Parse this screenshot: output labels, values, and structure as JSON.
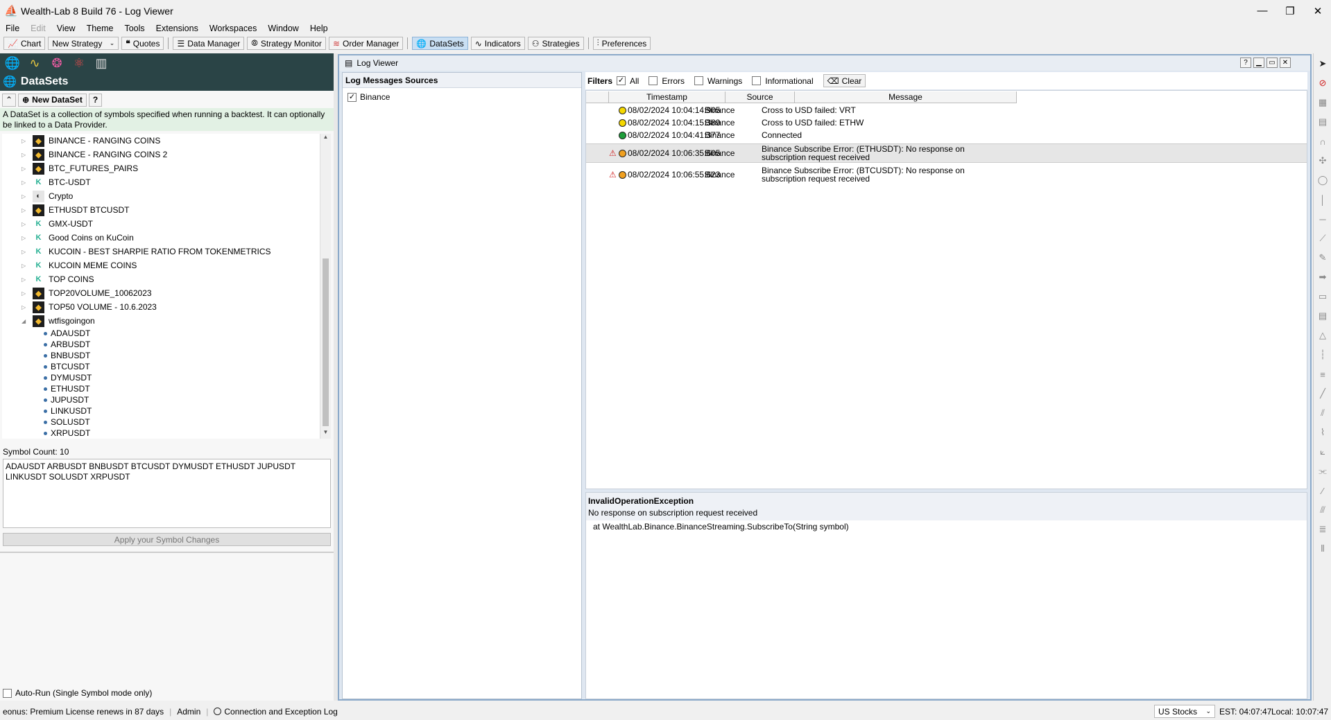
{
  "window": {
    "title": "Wealth-Lab 8 Build 76 - Log Viewer",
    "minimize": "—",
    "restore": "❐",
    "close": "✕"
  },
  "menu": [
    "File",
    "Edit",
    "View",
    "Theme",
    "Tools",
    "Extensions",
    "Workspaces",
    "Window",
    "Help"
  ],
  "toolbar": {
    "chart": "Chart",
    "new_strategy": "New Strategy",
    "quotes": "Quotes",
    "data_manager": "Data Manager",
    "strategy_monitor": "Strategy Monitor",
    "order_manager": "Order Manager",
    "datasets": "DataSets",
    "indicators": "Indicators",
    "strategies": "Strategies",
    "preferences": "Preferences"
  },
  "datasets_panel": {
    "title": "DataSets",
    "new_dataset": "New DataSet",
    "help": "?",
    "description": "A DataSet is a collection of symbols specified when running a backtest. It can optionally be linked to a Data Provider.",
    "items": [
      {
        "name": "BINANCE - RANGING COINS",
        "provider": "binance"
      },
      {
        "name": "BINANCE - RANGING COINS 2",
        "provider": "binance"
      },
      {
        "name": "BTC_FUTURES_PAIRS",
        "provider": "binance"
      },
      {
        "name": "BTC-USDT",
        "provider": "kucoin"
      },
      {
        "name": "Crypto",
        "provider": "other"
      },
      {
        "name": "ETHUSDT BTCUSDT",
        "provider": "binance"
      },
      {
        "name": "GMX-USDT",
        "provider": "kucoin"
      },
      {
        "name": "Good Coins on KuCoin",
        "provider": "kucoin"
      },
      {
        "name": "KUCOIN - BEST SHARPIE RATIO FROM TOKENMETRICS",
        "provider": "kucoin"
      },
      {
        "name": "KUCOIN MEME COINS",
        "provider": "kucoin"
      },
      {
        "name": "TOP COINS",
        "provider": "kucoin"
      },
      {
        "name": "TOP20VOLUME_10062023",
        "provider": "binance"
      },
      {
        "name": "TOP50 VOLUME - 10.6.2023",
        "provider": "binance"
      },
      {
        "name": "wtfisgoingon",
        "provider": "binance"
      }
    ],
    "expanded_symbols": [
      "ADAUSDT",
      "ARBUSDT",
      "BNBUSDT",
      "BTCUSDT",
      "DYMUSDT",
      "ETHUSDT",
      "JUPUSDT",
      "LINKUSDT",
      "SOLUSDT",
      "XRPUSDT"
    ],
    "symbol_count": "Symbol Count: 10",
    "symbols_text": "ADAUSDT ARBUSDT BNBUSDT BTCUSDT DYMUSDT ETHUSDT JUPUSDT LINKUSDT SOLUSDT XRPUSDT",
    "apply": "Apply your Symbol Changes",
    "autorun": "Auto-Run (Single Symbol mode only)"
  },
  "log_viewer": {
    "title": "Log Viewer",
    "sources_header": "Log Messages Sources",
    "sources": [
      {
        "name": "Binance",
        "checked": true
      }
    ],
    "filters_label": "Filters",
    "filters": {
      "all": "All",
      "errors": "Errors",
      "warnings": "Warnings",
      "informational": "Informational",
      "clear": "Clear"
    },
    "columns": {
      "timestamp": "Timestamp",
      "source": "Source",
      "message": "Message"
    },
    "rows": [
      {
        "warn": false,
        "dot": "#f5d800",
        "timestamp": "08/02/2024 10:04:14:905",
        "source": "Binance",
        "message": "Cross to USD failed: VRT",
        "message2": ""
      },
      {
        "warn": false,
        "dot": "#f5d800",
        "timestamp": "08/02/2024 10:04:15:389",
        "source": "Binance",
        "message": "Cross to USD failed: ETHW",
        "message2": ""
      },
      {
        "warn": false,
        "dot": "#1e9e3a",
        "timestamp": "08/02/2024 10:04:41:377",
        "source": "Binance",
        "message": "Connected",
        "message2": ""
      },
      {
        "warn": true,
        "dot": "#f0a020",
        "timestamp": "08/02/2024 10:06:35:605",
        "source": "Binance",
        "message": "Binance Subscribe Error: (ETHUSDT): No response on",
        "message2": "subscription request received"
      },
      {
        "warn": true,
        "dot": "#f0a020",
        "timestamp": "08/02/2024 10:06:55:623",
        "source": "Binance",
        "message": "Binance Subscribe Error: (BTCUSDT): No response on",
        "message2": "subscription request received"
      }
    ],
    "detail": {
      "exception": "InvalidOperationException",
      "message": "No response on subscription request received",
      "stack": "at WealthLab.Binance.BinanceStreaming.SubscribeTo(String symbol)"
    }
  },
  "status": {
    "license": "eonus: Premium License renews in 87 days",
    "user": "Admin",
    "log_link": "Connection and Exception Log",
    "market": "US Stocks",
    "est": "EST: 04:07:47",
    "local": "Local: 10:07:47"
  }
}
